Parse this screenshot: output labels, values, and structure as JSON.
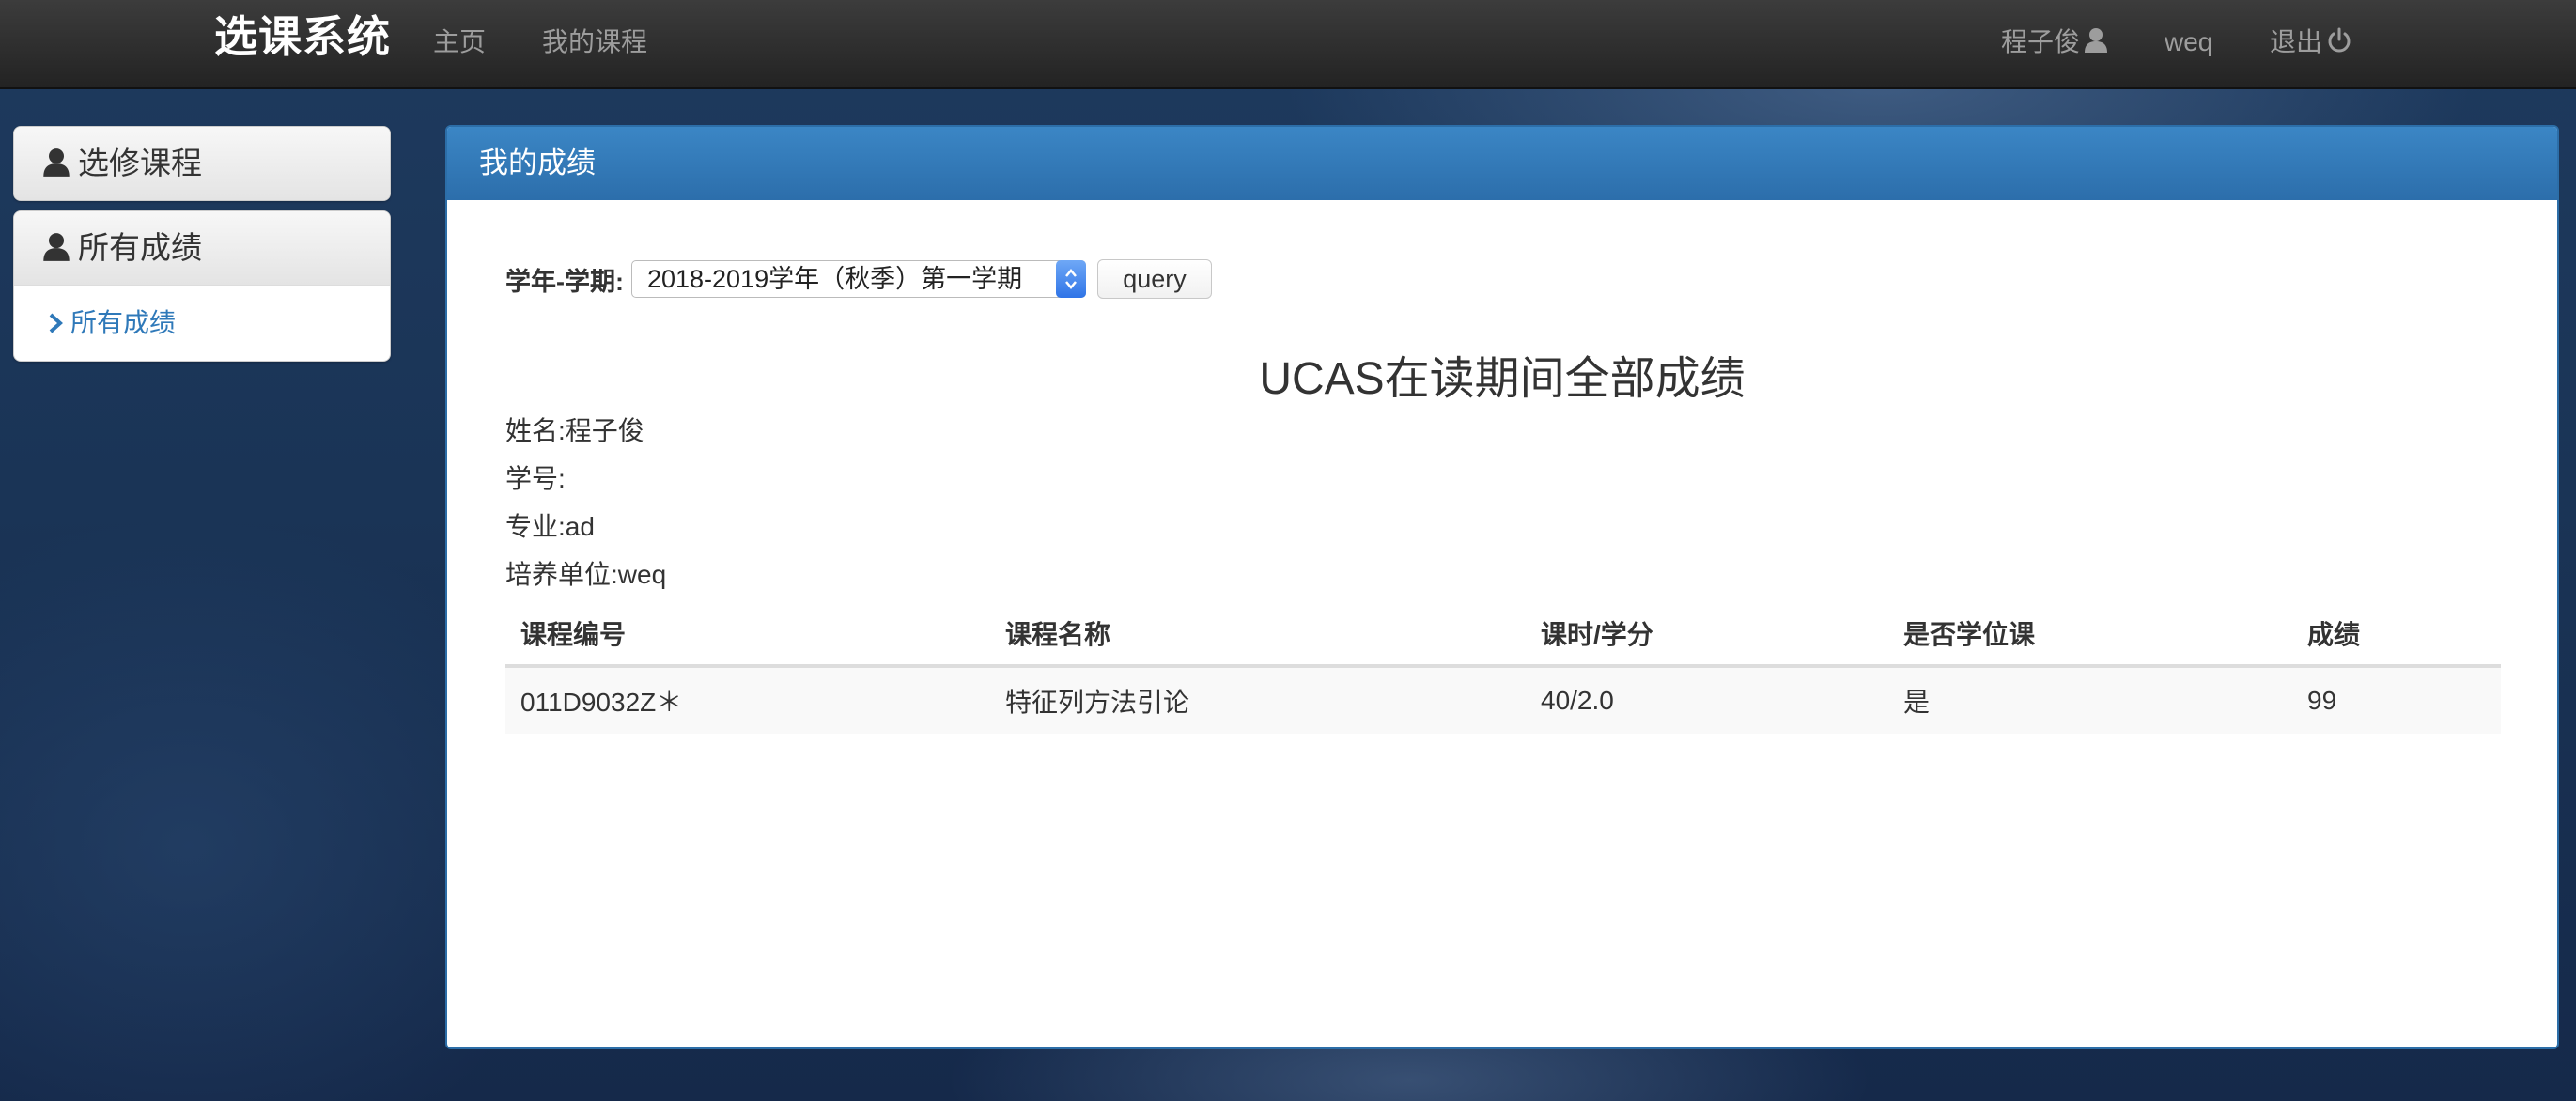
{
  "navbar": {
    "brand": "选课系统",
    "links": [
      "主页",
      "我的课程"
    ],
    "user_name": "程子俊",
    "user_extra": "weq",
    "logout": "退出"
  },
  "sidebar": {
    "panels": [
      {
        "heading": "选修课程"
      },
      {
        "heading": "所有成绩",
        "items": [
          "所有成绩"
        ]
      }
    ]
  },
  "main": {
    "heading": "我的成绩",
    "filter": {
      "label": "学年-学期:",
      "selected": "2018-2019学年（秋季）第一学期",
      "button": "query"
    },
    "report_title": "UCAS在读期间全部成绩",
    "info": {
      "name": "姓名:程子俊",
      "student_id": "学号:",
      "major": "专业:ad",
      "unit": "培养单位:weq"
    },
    "table": {
      "headers": [
        "课程编号",
        "课程名称",
        "课时/学分",
        "是否学位课",
        "成绩"
      ],
      "rows": [
        [
          "011D9032Z＊",
          "特征列方法引论",
          "40/2.0",
          "是",
          "99"
        ]
      ]
    }
  },
  "colors": {
    "navbar_bg": "#2b2b2b",
    "panel_header": "#337ab7",
    "link": "#2f79b9"
  }
}
